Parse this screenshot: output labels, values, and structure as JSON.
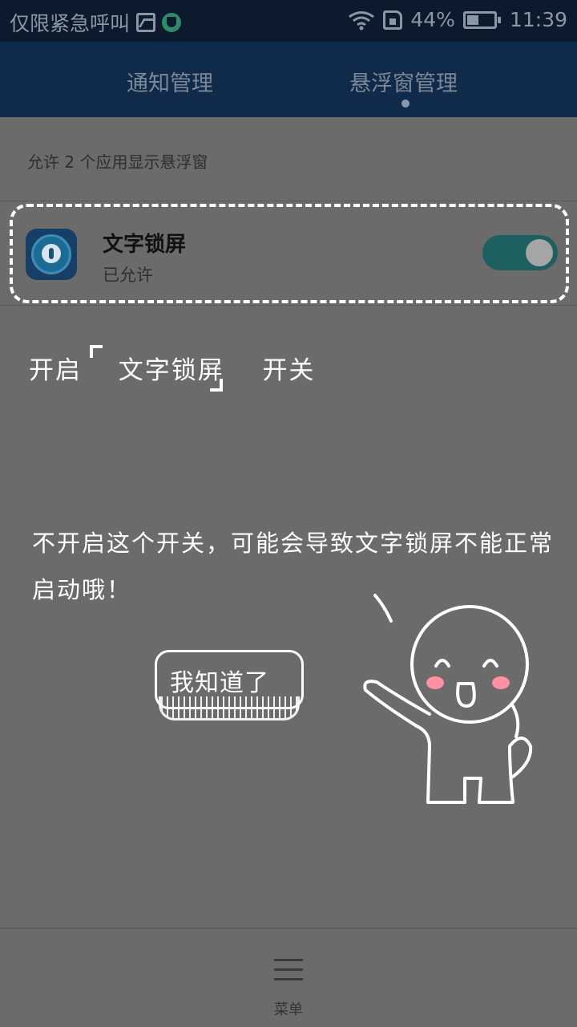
{
  "status_bar": {
    "carrier": "仅限紧急呼叫",
    "battery": "44%",
    "time": "11:39",
    "icons": [
      "image-icon",
      "shield-icon",
      "wifi-icon",
      "sim-icon",
      "battery-icon"
    ]
  },
  "tabs": [
    {
      "label": "通知管理",
      "selected": false
    },
    {
      "label": "悬浮窗管理",
      "selected": true
    }
  ],
  "summary": "允许 2 个应用显示悬浮窗",
  "app": {
    "name": "文字锁屏",
    "status": "已允许",
    "enabled": true,
    "icon": "lock-app-icon"
  },
  "overlay": {
    "hint_prefix": "开启",
    "hint_app": "文字锁屏",
    "hint_suffix": "开关",
    "warning": "不开启这个开关，可能会导致文字锁屏不能正常启动哦！",
    "confirm_button": "我知道了"
  },
  "bottom_bar": {
    "menu_label": "菜单",
    "menu_icon": "menu-icon"
  },
  "colors": {
    "header": "#0f2a4a",
    "toggle_on": "#1e5f5f",
    "overlay_text": "#ffffff"
  }
}
